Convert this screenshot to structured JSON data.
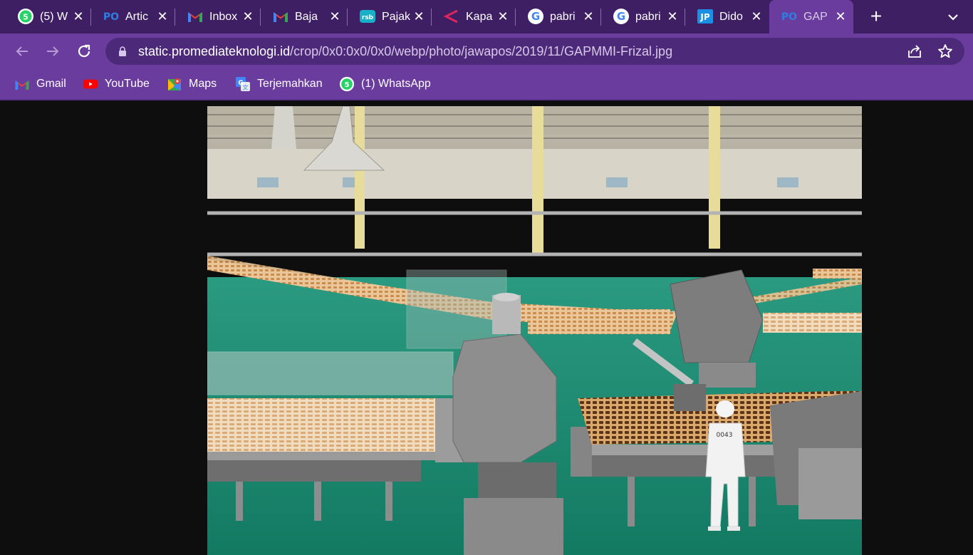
{
  "tabs": [
    {
      "title": "(5) W",
      "favicon": "whatsapp-icon",
      "active": false
    },
    {
      "title": "Artic",
      "favicon": "pomedia-icon",
      "active": false
    },
    {
      "title": "Inbox",
      "favicon": "gmail-icon",
      "active": false
    },
    {
      "title": "Baja",
      "favicon": "gmail-icon",
      "active": false
    },
    {
      "title": "Pajak",
      "favicon": "rsb-icon",
      "active": false
    },
    {
      "title": "Kapa",
      "favicon": "share-icon",
      "active": false
    },
    {
      "title": "pabri",
      "favicon": "google-icon",
      "active": false
    },
    {
      "title": "pabri",
      "favicon": "google-icon",
      "active": false
    },
    {
      "title": "Dido",
      "favicon": "jp-icon",
      "active": false
    },
    {
      "title": "GAP",
      "favicon": "pomedia-icon",
      "active": true
    }
  ],
  "address": {
    "host": "static.promediateknologi.id",
    "path": "/crop/0x0:0x0/0x0/webp/photo/jawapos/2019/11/GAPMMI-Frizal.jpg"
  },
  "bookmarks": [
    {
      "label": "Gmail",
      "icon": "gmail-icon"
    },
    {
      "label": "YouTube",
      "icon": "youtube-icon"
    },
    {
      "label": "Maps",
      "icon": "maps-icon"
    },
    {
      "label": "Terjemahkan",
      "icon": "translate-icon"
    },
    {
      "label": "(1) WhatsApp",
      "icon": "whatsapp-icon"
    }
  ],
  "worker_badge": "0043",
  "colors": {
    "tabbar": "#3e1f63",
    "toolbar": "#6a3c9e",
    "omnibox": "#4d2a79",
    "page_bg": "#0e0e0e",
    "factory_floor": "#1f8a72"
  }
}
